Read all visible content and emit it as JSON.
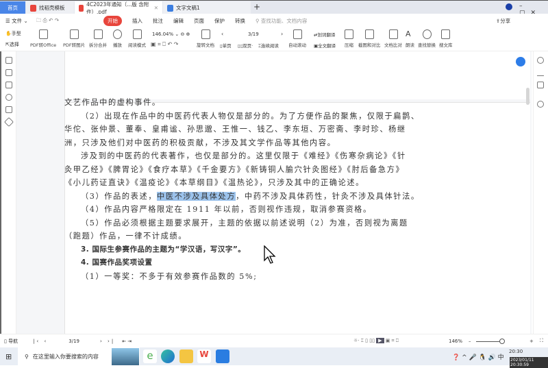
{
  "tabs": [
    {
      "label": "首页"
    },
    {
      "label": "找稻壳模板"
    },
    {
      "label": "4C2023年通知（...版 含附件）.pdf"
    },
    {
      "label": "文字文稿1"
    }
  ],
  "menu": {
    "file": "文件",
    "items": [
      "开始",
      "插入",
      "批注",
      "编辑",
      "页面",
      "保护",
      "转换"
    ],
    "search_placeholder": "查找功能、文档内容",
    "share": "分享"
  },
  "toolbar": {
    "hand": "手型",
    "select": "选择",
    "pdf_office": "PDF转Office",
    "pdf_image": "PDF转图片",
    "split_merge": "拆分合并",
    "play": "播放",
    "read_mode": "阅读模式",
    "zoom": "146.04%",
    "rotate": "旋转文档",
    "page": "3/19",
    "single": "单页",
    "double": "双页",
    "continuous": "连续阅读",
    "auto_scroll": "自动滚动",
    "word_translate": "划词翻译",
    "full_translate": "全文翻译",
    "compress": "压缩",
    "screenshot": "截图和对比",
    "compare": "文档比对",
    "read_aloud": "朗读",
    "find_replace": "查找替换",
    "search_lib": "搜文库"
  },
  "doc": {
    "l1": "文艺作品中的虚构事件。",
    "l2": "（2）出现在作品中的中医药代表人物仅是部分的。为了方便作品的聚焦，仅限于扁鹊、",
    "l3": "华佗、张仲景、董奉、皇甫谧、孙思邈、王惟一、钱乙、李东垣、万密斋、李时珍、杨继",
    "l4": "洲，只涉及他们对中医药的积极贡献，不涉及其文学作品等其他内容。",
    "l5": "涉及到的中医药的代表著作，也仅是部分的。这里仅限于《难经》《伤寒杂病论》《针",
    "l6": "灸甲乙经》《脾胃论》《食疗本草》《千金要方》《新铸铜人腧穴针灸图经》《肘后备急方》",
    "l7": "《小儿药证直诀》《温疫论》《本草纲目》《温热论》，只涉及其中的正确论述。",
    "l8a": "（3）作品的表述，",
    "l8hl": "中医不涉及具体处方",
    "l8b": "，中药不涉及具体药性，针灸不涉及具体针法。",
    "l9": "（4）作品内容严格限定在 1911 年以前，否则视作违规，取消参赛资格。",
    "l10": "（5）作品必须根据主题要求展开，主题的依据以前述说明（2）为准，否则视为离题",
    "l11": "（跑题）作品，一律不计成绩。",
    "h3": "3. 国际生参赛作品的主题为“学汉语，写汉字”。",
    "h4": "4. 国赛作品奖项设置",
    "l12": "（1）一等奖：不多于有效参赛作品数的 5%;"
  },
  "status": {
    "nav": "导航",
    "page": "3/19",
    "zoom": "146%"
  },
  "taskbar": {
    "search_placeholder": "在这里输入你要搜索的内容",
    "time": "20:30",
    "date": "2023/01/11 20:30:59",
    "ime": "中"
  }
}
